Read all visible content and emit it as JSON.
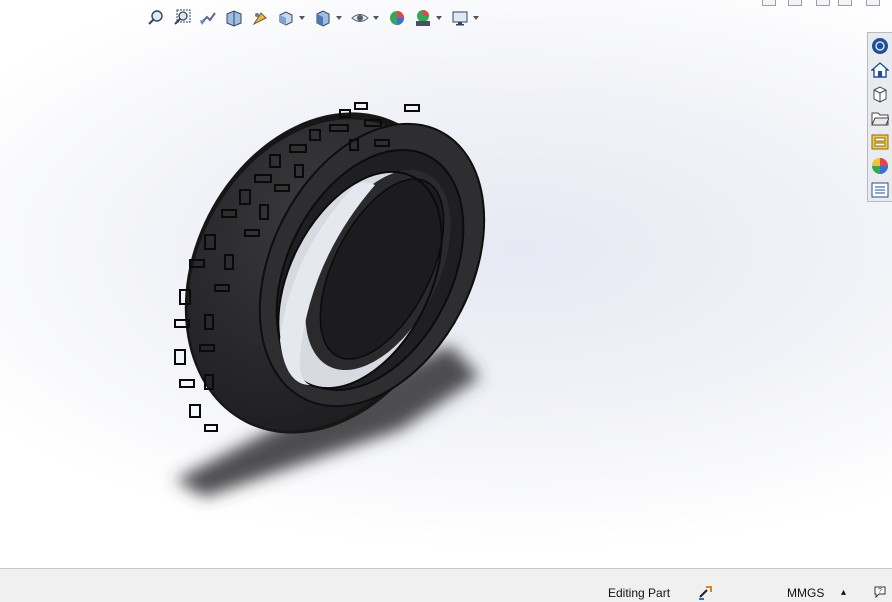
{
  "toolbar": {
    "buttons": [
      {
        "name": "zoom-to-fit-icon"
      },
      {
        "name": "zoom-to-area-icon"
      },
      {
        "name": "previous-view-icon"
      },
      {
        "name": "section-view-icon"
      },
      {
        "name": "dynamic-annotation-views-icon"
      },
      {
        "name": "view-orientation-icon",
        "dropdown": true
      },
      {
        "name": "display-style-icon",
        "dropdown": true
      },
      {
        "name": "hide-show-items-icon",
        "dropdown": true
      },
      {
        "name": "edit-appearance-icon"
      },
      {
        "name": "apply-scene-icon",
        "dropdown": true
      },
      {
        "name": "view-settings-icon",
        "dropdown": true
      }
    ]
  },
  "taskpane": {
    "items": [
      {
        "name": "solidworks-resources-icon"
      },
      {
        "name": "home-icon"
      },
      {
        "name": "design-library-icon"
      },
      {
        "name": "file-explorer-icon"
      },
      {
        "name": "view-palette-icon"
      },
      {
        "name": "appearances-scenes-decals-icon"
      },
      {
        "name": "custom-properties-icon"
      }
    ]
  },
  "statusbar": {
    "status_text": "Editing Part",
    "units": "MMGS",
    "units_arrow": "▴"
  },
  "colors": {
    "tire": "#2a2a2c",
    "tire_edge": "#0c0c0d",
    "background_top": "#e6e9f3",
    "statusbar_bg": "#f0f0f0"
  }
}
